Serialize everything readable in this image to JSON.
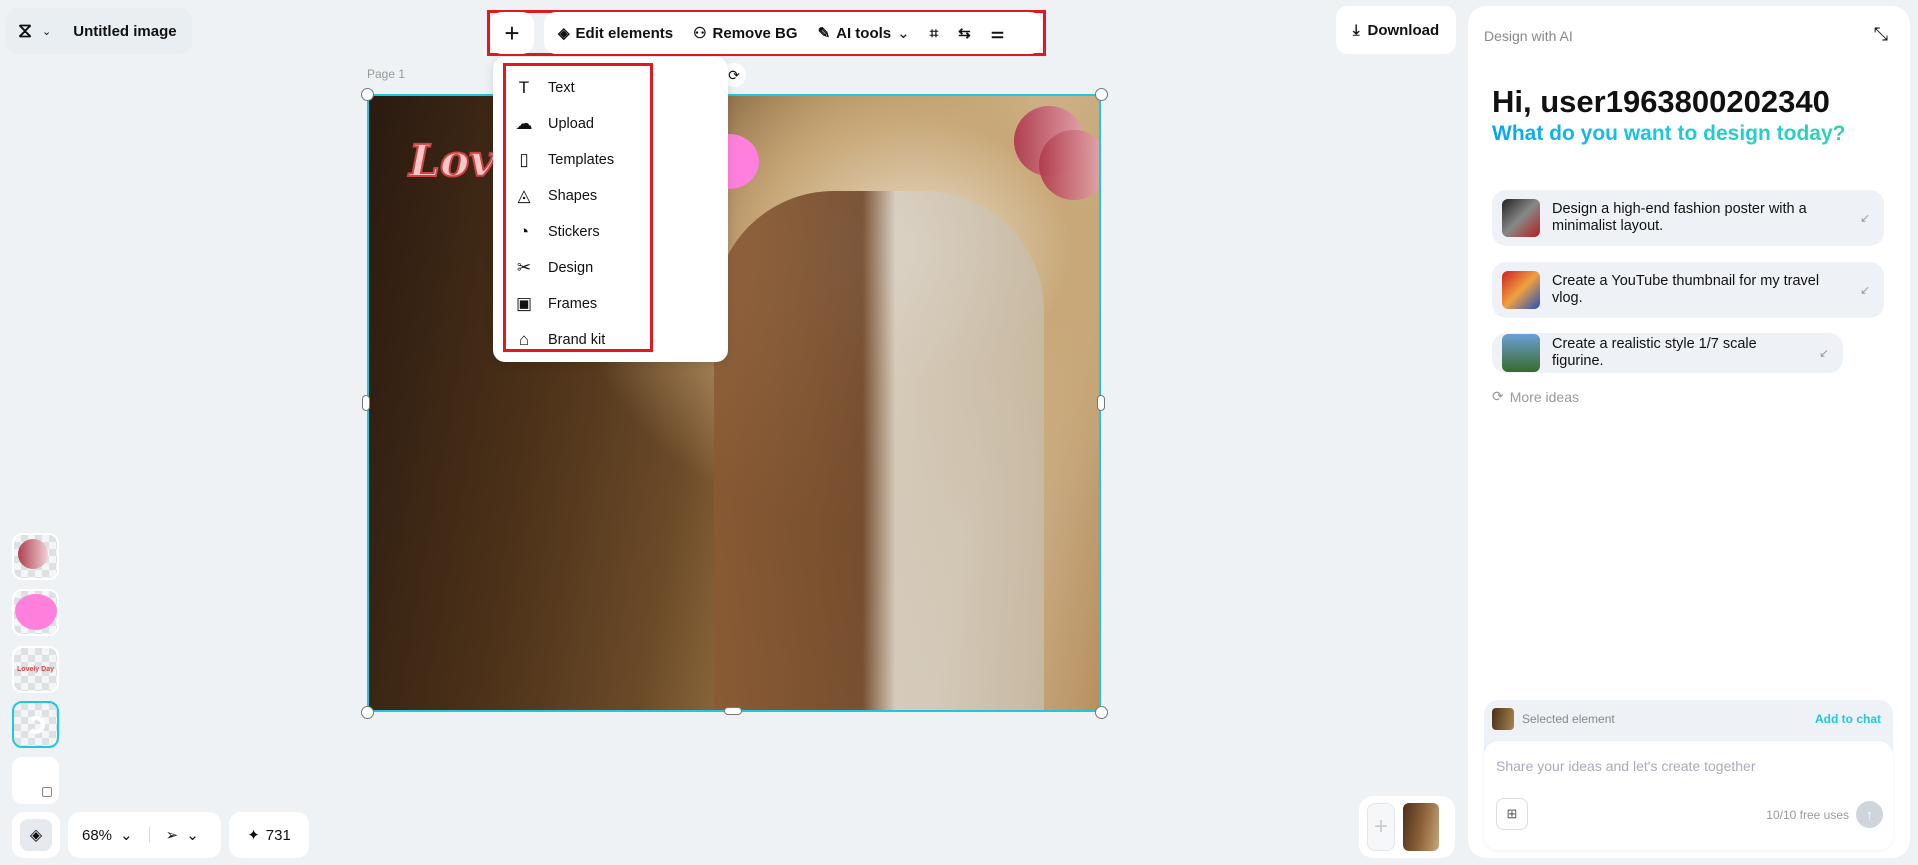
{
  "header": {
    "title": "Untitled image",
    "logo": "capcut-logo"
  },
  "toolbar": {
    "add": "+",
    "edit_elements": "Edit elements",
    "remove_bg": "Remove BG",
    "ai_tools": "AI tools"
  },
  "download": "Download",
  "page_label": "Page 1",
  "canvas": {
    "text_fragment": "Lov"
  },
  "add_menu": {
    "items": [
      {
        "label": "Text",
        "icon": "text-icon"
      },
      {
        "label": "Upload",
        "icon": "upload-icon"
      },
      {
        "label": "Templates",
        "icon": "templates-icon"
      },
      {
        "label": "Shapes",
        "icon": "shapes-icon"
      },
      {
        "label": "Stickers",
        "icon": "stickers-icon"
      },
      {
        "label": "Design",
        "icon": "design-icon"
      },
      {
        "label": "Frames",
        "icon": "frames-icon"
      },
      {
        "label": "Brand kit",
        "icon": "brand-kit-icon"
      }
    ]
  },
  "layers": {
    "text_thumb": "Lovely Day"
  },
  "bottom": {
    "zoom": "68%",
    "credits": "731"
  },
  "ai_panel": {
    "title": "Design with AI",
    "greeting": "Hi, user1963800202340",
    "subtitle": "What do you want to design today?",
    "suggestions": [
      "Design a high-end fashion poster with a minimalist layout.",
      "Create a YouTube thumbnail for my travel vlog.",
      "Create a realistic style 1/7 scale figurine."
    ],
    "more_ideas": "More ideas",
    "selected_element": "Selected element",
    "add_to_chat": "Add to chat",
    "input_placeholder": "Share your ideas and let's create together",
    "free_uses": "10/10 free uses"
  },
  "colors": {
    "accent": "#1ec8e0",
    "highlight": "#e0191f"
  }
}
